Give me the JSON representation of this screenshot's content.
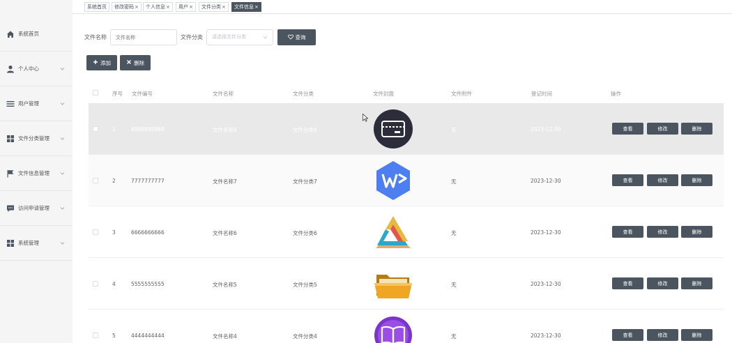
{
  "sidebar": {
    "items": [
      {
        "label": "系统首页",
        "icon": "home-icon",
        "chevron": false
      },
      {
        "label": "个人中心",
        "icon": "user-icon",
        "chevron": true
      },
      {
        "label": "用户管理",
        "icon": "list-icon",
        "chevron": true
      },
      {
        "label": "文件分类管理",
        "icon": "grid-icon",
        "chevron": true
      },
      {
        "label": "文件信息管理",
        "icon": "flag-icon",
        "chevron": true
      },
      {
        "label": "访问申请管理",
        "icon": "chat-icon",
        "chevron": true
      },
      {
        "label": "系统管理",
        "icon": "grid-icon",
        "chevron": true
      }
    ]
  },
  "tabs": [
    {
      "label": "系统首页",
      "closable": false,
      "active": false
    },
    {
      "label": "修改密码",
      "closable": true,
      "active": false
    },
    {
      "label": "个人信息",
      "closable": true,
      "active": false
    },
    {
      "label": "用户",
      "closable": true,
      "active": false
    },
    {
      "label": "文件分类",
      "closable": true,
      "active": false
    },
    {
      "label": "文件信息",
      "closable": true,
      "active": true
    }
  ],
  "tab_close": "×",
  "filter": {
    "name_label": "文件名称",
    "name_placeholder": "文件名称",
    "category_label": "文件分类",
    "category_placeholder": "请选择文件分类",
    "query_button": "查询"
  },
  "toolbar": {
    "add_button": "添加",
    "delete_button": "删除"
  },
  "table": {
    "headers": [
      "序号",
      "文件编号",
      "文件名称",
      "文件分类",
      "文件封面",
      "文件附件",
      "登记时间",
      "操作"
    ],
    "rows": [
      {
        "index": "1",
        "code": "8888888888",
        "name": "文件名称8",
        "category": "文件分类8",
        "cover": "card-icon",
        "attachment": "无",
        "date": "2023-12-30",
        "highlighted": true
      },
      {
        "index": "2",
        "code": "7777777777",
        "name": "文件名称7",
        "category": "文件分类7",
        "cover": "wps-icon",
        "attachment": "无",
        "date": "2023-12-30",
        "highlighted": false
      },
      {
        "index": "3",
        "code": "6666666666",
        "name": "文件名称6",
        "category": "文件分类6",
        "cover": "triangle-logo-icon",
        "attachment": "无",
        "date": "2023-12-30",
        "highlighted": false
      },
      {
        "index": "4",
        "code": "5555555555",
        "name": "文件名称5",
        "category": "文件分类5",
        "cover": "folder-icon",
        "attachment": "无",
        "date": "2023-12-30",
        "highlighted": false
      },
      {
        "index": "5",
        "code": "4444444444",
        "name": "文件名称4",
        "category": "文件分类4",
        "cover": "book-icon",
        "attachment": "无",
        "date": "2023-12-30",
        "highlighted": false
      }
    ],
    "actions": {
      "view": "查看",
      "edit": "修改",
      "delete": "删除"
    }
  },
  "colors": {
    "button_dark": "#4a5560",
    "sidebar_bg": "#f5f5f5",
    "row_highlight": "#e9e9e9"
  }
}
